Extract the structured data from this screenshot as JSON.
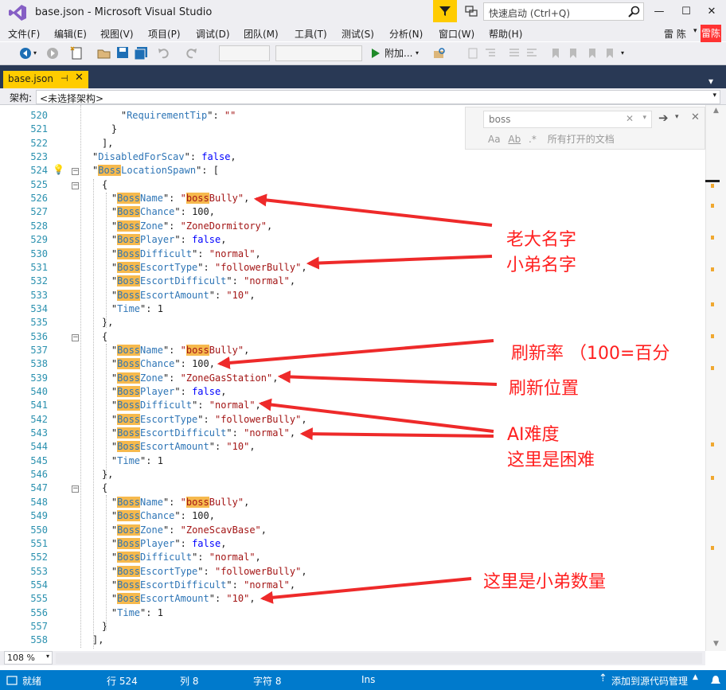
{
  "window": {
    "title": "base.json - Microsoft Visual Studio",
    "quick_launch_placeholder": "快速启动 (Ctrl+Q)",
    "minimize": "—",
    "maximize": "☐",
    "close": "✕"
  },
  "menu": [
    "文件(F)",
    "编辑(E)",
    "视图(V)",
    "项目(P)",
    "调试(D)",
    "团队(M)",
    "工具(T)",
    "测试(S)",
    "分析(N)",
    "窗口(W)",
    "帮助(H)"
  ],
  "user": {
    "name": "雷 陈",
    "avatar_text": "雷陈"
  },
  "toolbar": {
    "attach_label": "附加..."
  },
  "tab": {
    "label": "base.json",
    "pin": "⊣",
    "close": "✕"
  },
  "navbar": {
    "label": "架构:",
    "combo_value": "<未选择架构>"
  },
  "find": {
    "query": "boss",
    "scope": "所有打开的文档"
  },
  "code_lines": [
    {
      "n": 520,
      "indent": 3,
      "t": [
        [
          "p",
          "\""
        ],
        [
          "k",
          "RequirementTip"
        ],
        [
          "p",
          "\": "
        ],
        [
          "v",
          "\"\""
        ]
      ]
    },
    {
      "n": 521,
      "indent": 2,
      "t": [
        [
          "p",
          "}"
        ]
      ]
    },
    {
      "n": 522,
      "indent": 1,
      "t": [
        [
          "p",
          "],"
        ]
      ]
    },
    {
      "n": 523,
      "indent": 0,
      "t": [
        [
          "p",
          "\""
        ],
        [
          "k",
          "DisabledForScav"
        ],
        [
          "p",
          "\": "
        ],
        [
          "kw",
          "false"
        ],
        [
          "p",
          ","
        ]
      ]
    },
    {
      "n": 524,
      "indent": 0,
      "t": [
        [
          "p",
          "\""
        ],
        [
          "hl",
          "Boss"
        ],
        [
          "k",
          "LocationSpawn"
        ],
        [
          "p",
          "\": ["
        ]
      ]
    },
    {
      "n": 525,
      "indent": 1,
      "t": [
        [
          "p",
          "{"
        ]
      ]
    },
    {
      "n": 526,
      "indent": 2,
      "t": [
        [
          "p",
          "\""
        ],
        [
          "hl",
          "Boss"
        ],
        [
          "k",
          "Name"
        ],
        [
          "p",
          "\": "
        ],
        [
          "v",
          "\""
        ],
        [
          "hlv",
          "boss"
        ],
        [
          "v",
          "Bully\""
        ],
        [
          "p",
          ","
        ]
      ]
    },
    {
      "n": 527,
      "indent": 2,
      "t": [
        [
          "p",
          "\""
        ],
        [
          "hl",
          "Boss"
        ],
        [
          "k",
          "Chance"
        ],
        [
          "p",
          "\": 100,"
        ]
      ]
    },
    {
      "n": 528,
      "indent": 2,
      "t": [
        [
          "p",
          "\""
        ],
        [
          "hl",
          "Boss"
        ],
        [
          "k",
          "Zone"
        ],
        [
          "p",
          "\": "
        ],
        [
          "v",
          "\"ZoneDormitory\""
        ],
        [
          "p",
          ","
        ]
      ]
    },
    {
      "n": 529,
      "indent": 2,
      "t": [
        [
          "p",
          "\""
        ],
        [
          "hl",
          "Boss"
        ],
        [
          "k",
          "Player"
        ],
        [
          "p",
          "\": "
        ],
        [
          "kw",
          "false"
        ],
        [
          "p",
          ","
        ]
      ]
    },
    {
      "n": 530,
      "indent": 2,
      "t": [
        [
          "p",
          "\""
        ],
        [
          "hl",
          "Boss"
        ],
        [
          "k",
          "Difficult"
        ],
        [
          "p",
          "\": "
        ],
        [
          "v",
          "\"normal\""
        ],
        [
          "p",
          ","
        ]
      ]
    },
    {
      "n": 531,
      "indent": 2,
      "t": [
        [
          "p",
          "\""
        ],
        [
          "hl",
          "Boss"
        ],
        [
          "k",
          "EscortType"
        ],
        [
          "p",
          "\": "
        ],
        [
          "v",
          "\"followerBully\""
        ],
        [
          "p",
          ","
        ]
      ]
    },
    {
      "n": 532,
      "indent": 2,
      "t": [
        [
          "p",
          "\""
        ],
        [
          "hl",
          "Boss"
        ],
        [
          "k",
          "EscortDifficult"
        ],
        [
          "p",
          "\": "
        ],
        [
          "v",
          "\"normal\""
        ],
        [
          "p",
          ","
        ]
      ]
    },
    {
      "n": 533,
      "indent": 2,
      "t": [
        [
          "p",
          "\""
        ],
        [
          "hl",
          "Boss"
        ],
        [
          "k",
          "EscortAmount"
        ],
        [
          "p",
          "\": "
        ],
        [
          "v",
          "\"10\""
        ],
        [
          "p",
          ","
        ]
      ]
    },
    {
      "n": 534,
      "indent": 2,
      "t": [
        [
          "p",
          "\""
        ],
        [
          "k",
          "Time"
        ],
        [
          "p",
          "\": 1"
        ]
      ]
    },
    {
      "n": 535,
      "indent": 1,
      "t": [
        [
          "p",
          "},"
        ]
      ]
    },
    {
      "n": 536,
      "indent": 1,
      "t": [
        [
          "p",
          "{"
        ]
      ]
    },
    {
      "n": 537,
      "indent": 2,
      "t": [
        [
          "p",
          "\""
        ],
        [
          "hl",
          "Boss"
        ],
        [
          "k",
          "Name"
        ],
        [
          "p",
          "\": "
        ],
        [
          "v",
          "\""
        ],
        [
          "hlv",
          "boss"
        ],
        [
          "v",
          "Bully\""
        ],
        [
          "p",
          ","
        ]
      ]
    },
    {
      "n": 538,
      "indent": 2,
      "t": [
        [
          "p",
          "\""
        ],
        [
          "hl",
          "Boss"
        ],
        [
          "k",
          "Chance"
        ],
        [
          "p",
          "\": 100,"
        ]
      ]
    },
    {
      "n": 539,
      "indent": 2,
      "t": [
        [
          "p",
          "\""
        ],
        [
          "hl",
          "Boss"
        ],
        [
          "k",
          "Zone"
        ],
        [
          "p",
          "\": "
        ],
        [
          "v",
          "\"ZoneGasStation\""
        ],
        [
          "p",
          ","
        ]
      ]
    },
    {
      "n": 540,
      "indent": 2,
      "t": [
        [
          "p",
          "\""
        ],
        [
          "hl",
          "Boss"
        ],
        [
          "k",
          "Player"
        ],
        [
          "p",
          "\": "
        ],
        [
          "kw",
          "false"
        ],
        [
          "p",
          ","
        ]
      ]
    },
    {
      "n": 541,
      "indent": 2,
      "t": [
        [
          "p",
          "\""
        ],
        [
          "hl",
          "Boss"
        ],
        [
          "k",
          "Difficult"
        ],
        [
          "p",
          "\": "
        ],
        [
          "v",
          "\"normal\""
        ],
        [
          "p",
          ","
        ]
      ]
    },
    {
      "n": 542,
      "indent": 2,
      "t": [
        [
          "p",
          "\""
        ],
        [
          "hl",
          "Boss"
        ],
        [
          "k",
          "EscortType"
        ],
        [
          "p",
          "\": "
        ],
        [
          "v",
          "\"followerBully\""
        ],
        [
          "p",
          ","
        ]
      ]
    },
    {
      "n": 543,
      "indent": 2,
      "t": [
        [
          "p",
          "\""
        ],
        [
          "hl",
          "Boss"
        ],
        [
          "k",
          "EscortDifficult"
        ],
        [
          "p",
          "\": "
        ],
        [
          "v",
          "\"normal\""
        ],
        [
          "p",
          ","
        ]
      ]
    },
    {
      "n": 544,
      "indent": 2,
      "t": [
        [
          "p",
          "\""
        ],
        [
          "hl",
          "Boss"
        ],
        [
          "k",
          "EscortAmount"
        ],
        [
          "p",
          "\": "
        ],
        [
          "v",
          "\"10\""
        ],
        [
          "p",
          ","
        ]
      ]
    },
    {
      "n": 545,
      "indent": 2,
      "t": [
        [
          "p",
          "\""
        ],
        [
          "k",
          "Time"
        ],
        [
          "p",
          "\": 1"
        ]
      ]
    },
    {
      "n": 546,
      "indent": 1,
      "t": [
        [
          "p",
          "},"
        ]
      ]
    },
    {
      "n": 547,
      "indent": 1,
      "t": [
        [
          "p",
          "{"
        ]
      ]
    },
    {
      "n": 548,
      "indent": 2,
      "t": [
        [
          "p",
          "\""
        ],
        [
          "hl",
          "Boss"
        ],
        [
          "k",
          "Name"
        ],
        [
          "p",
          "\": "
        ],
        [
          "v",
          "\""
        ],
        [
          "hlv",
          "boss"
        ],
        [
          "v",
          "Bully\""
        ],
        [
          "p",
          ","
        ]
      ]
    },
    {
      "n": 549,
      "indent": 2,
      "t": [
        [
          "p",
          "\""
        ],
        [
          "hl",
          "Boss"
        ],
        [
          "k",
          "Chance"
        ],
        [
          "p",
          "\": 100,"
        ]
      ]
    },
    {
      "n": 550,
      "indent": 2,
      "t": [
        [
          "p",
          "\""
        ],
        [
          "hl",
          "Boss"
        ],
        [
          "k",
          "Zone"
        ],
        [
          "p",
          "\": "
        ],
        [
          "v",
          "\"ZoneScavBase\""
        ],
        [
          "p",
          ","
        ]
      ]
    },
    {
      "n": 551,
      "indent": 2,
      "t": [
        [
          "p",
          "\""
        ],
        [
          "hl",
          "Boss"
        ],
        [
          "k",
          "Player"
        ],
        [
          "p",
          "\": "
        ],
        [
          "kw",
          "false"
        ],
        [
          "p",
          ","
        ]
      ]
    },
    {
      "n": 552,
      "indent": 2,
      "t": [
        [
          "p",
          "\""
        ],
        [
          "hl",
          "Boss"
        ],
        [
          "k",
          "Difficult"
        ],
        [
          "p",
          "\": "
        ],
        [
          "v",
          "\"normal\""
        ],
        [
          "p",
          ","
        ]
      ]
    },
    {
      "n": 553,
      "indent": 2,
      "t": [
        [
          "p",
          "\""
        ],
        [
          "hl",
          "Boss"
        ],
        [
          "k",
          "EscortType"
        ],
        [
          "p",
          "\": "
        ],
        [
          "v",
          "\"followerBully\""
        ],
        [
          "p",
          ","
        ]
      ]
    },
    {
      "n": 554,
      "indent": 2,
      "t": [
        [
          "p",
          "\""
        ],
        [
          "hl",
          "Boss"
        ],
        [
          "k",
          "EscortDifficult"
        ],
        [
          "p",
          "\": "
        ],
        [
          "v",
          "\"normal\""
        ],
        [
          "p",
          ","
        ]
      ]
    },
    {
      "n": 555,
      "indent": 2,
      "t": [
        [
          "p",
          "\""
        ],
        [
          "hl",
          "Boss"
        ],
        [
          "k",
          "EscortAmount"
        ],
        [
          "p",
          "\": "
        ],
        [
          "v",
          "\"10\""
        ],
        [
          "p",
          ","
        ]
      ]
    },
    {
      "n": 556,
      "indent": 2,
      "t": [
        [
          "p",
          "\""
        ],
        [
          "k",
          "Time"
        ],
        [
          "p",
          "\": 1"
        ]
      ]
    },
    {
      "n": 557,
      "indent": 1,
      "t": [
        [
          "p",
          "}"
        ]
      ]
    },
    {
      "n": 558,
      "indent": 0,
      "t": [
        [
          "p",
          "],"
        ]
      ]
    }
  ],
  "annotations": {
    "boss_name": "老大名字",
    "follower_name": "小弟名字",
    "spawn_rate": "刷新率  （100=百分",
    "spawn_location": "刷新位置",
    "ai_difficulty": "AI难度",
    "hard_here": "这里是困难",
    "follower_count": "这里是小弟数量"
  },
  "editor": {
    "zoom": "108 %"
  },
  "status": {
    "ready": "就绪",
    "line": "行 524",
    "col": "列 8",
    "char": "字符 8",
    "mode": "Ins",
    "source_control": "添加到源代码管理"
  },
  "colors": {
    "accent": "#007acc",
    "tab_active": "#ffcc00",
    "annotation": "#ff2020",
    "find_highlight": "#f6b94d"
  }
}
